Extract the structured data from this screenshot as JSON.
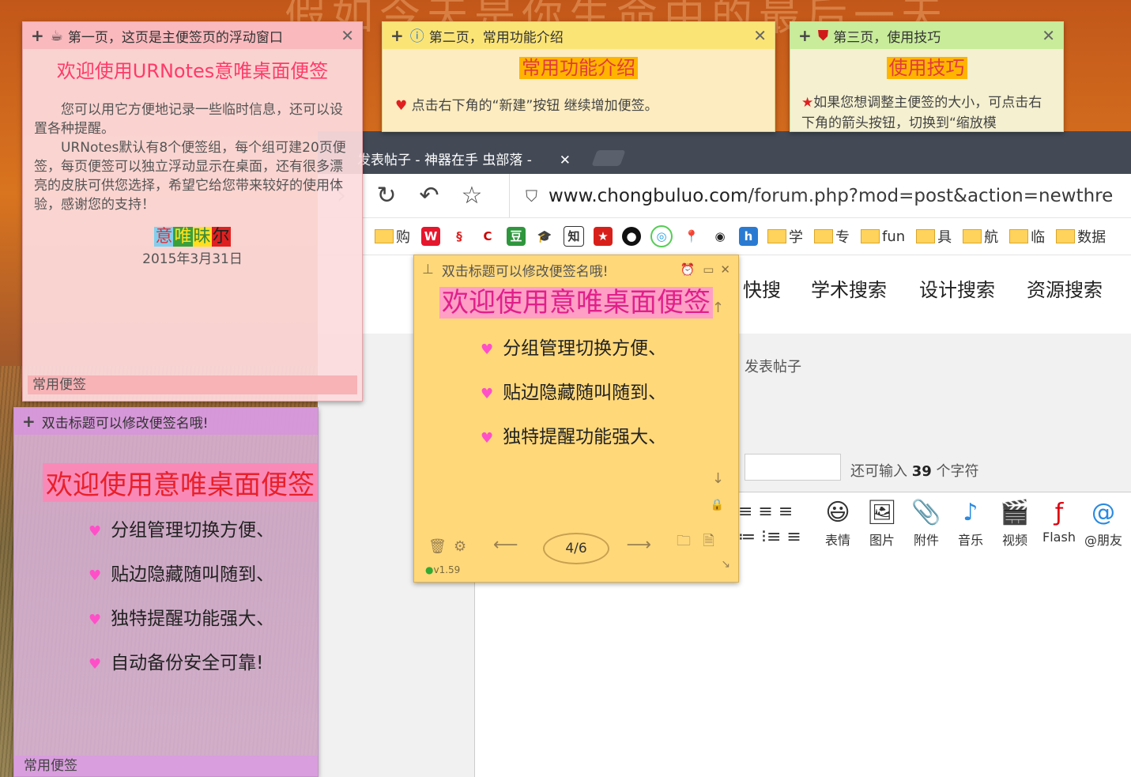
{
  "desktop": {
    "ghost_text": "假如今天是你生命中的最后一天"
  },
  "note1": {
    "title": "第一页，这页是主便签页的浮动窗口",
    "heading": "欢迎使用URNotes意唯桌面便签",
    "para1": "您可以用它方便地记录一些临时信息，还可以设置各种提醒。",
    "para2": "URNotes默认有8个便签组，每个组可建20页便签，每页便签可以独立浮动显示在桌面，还有很多漂亮的皮肤可供您选择，希望它给您带来较好的使用体验，感谢您的支持！",
    "chips": [
      "意",
      "唯",
      "昧",
      "尔"
    ],
    "date": "2015年3月31日",
    "footer": "常用便签"
  },
  "note2": {
    "title": "第二页，常用功能介绍",
    "heading": "常用功能介绍",
    "line": "点击右下角的“新建”按钮 继续增加便签。"
  },
  "note3": {
    "title": "第三页，使用技巧",
    "heading": "使用技巧",
    "line": "如果您想调整主便签的大小，可点击右下角的箭头按钮，切换到“缩放模"
  },
  "browser": {
    "tab_title": "发表帖子 - 神器在手 虫部落 -",
    "url_host": "www.chongbuluo.com",
    "url_path": "/forum.php?mod=post&action=newthre",
    "bookmarks": [
      "购",
      "学",
      "专",
      "fun",
      "具",
      "航",
      "临",
      "数据"
    ],
    "search_nav": [
      "快搜",
      "学术搜索",
      "设计搜索",
      "资源搜索"
    ],
    "breadcrumb": "发表帖子",
    "counter_prefix": "还可输入",
    "counter_value": "39",
    "counter_suffix": "个字符",
    "editor_tools": [
      "表情",
      "图片",
      "附件",
      "音乐",
      "视频",
      "Flash",
      "@朋友"
    ]
  },
  "note4": {
    "title": "双击标题可以修改便签名哦!",
    "heading": "欢迎使用意唯桌面便签",
    "items": [
      "分组管理切换方便、",
      "贴边隐藏随叫随到、",
      "独特提醒功能强大、"
    ],
    "page": "4/6",
    "version": "v1.59"
  },
  "note5": {
    "title": "双击标题可以修改便签名哦!",
    "heading": "欢迎使用意唯桌面便签",
    "items": [
      "分组管理切换方便、",
      "贴边隐藏随叫随到、",
      "独特提醒功能强大、",
      "自动备份安全可靠!"
    ],
    "footer": "常用便签"
  }
}
